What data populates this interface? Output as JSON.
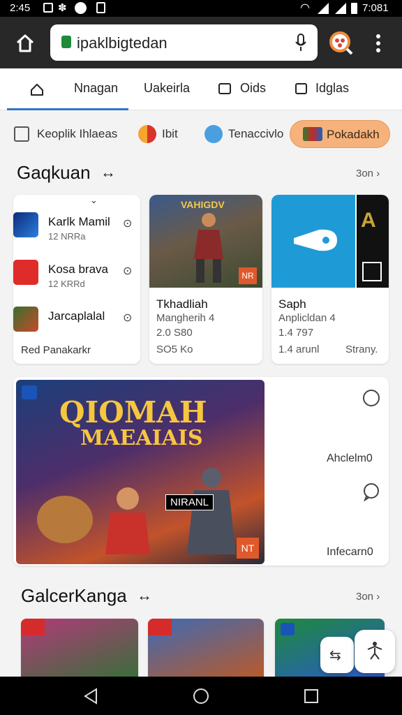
{
  "status": {
    "time_left": "2:45",
    "time_right": "7:081"
  },
  "toolbar": {
    "url": "ipaklbigtedan"
  },
  "tabs": [
    {
      "label": "Nnagan"
    },
    {
      "label": "Uakeirla"
    },
    {
      "label": "Oids"
    },
    {
      "label": "Idglas"
    }
  ],
  "chips": [
    {
      "label": "Keoplik Ihlaeas"
    },
    {
      "label": "Ibit"
    },
    {
      "label": "Tenaccivlo"
    },
    {
      "label": "Pokadakh"
    }
  ],
  "section1": {
    "title": "Gaqkuan",
    "see_all": "3on"
  },
  "list": [
    {
      "name": "Karlk Mamil",
      "sub": "12 NRRa"
    },
    {
      "name": "Kosa brava",
      "sub": "12 KRRd"
    },
    {
      "name": "Jarcaplalal",
      "sub": ""
    }
  ],
  "list_footer": "Red Panakarkr",
  "cards": [
    {
      "banner": "VAHIGDV",
      "title": "Tkhadliah",
      "sub1": "Mangherih 4",
      "sub2": "2.0 S80",
      "sub3": "SO5 Ko",
      "badge": "NR"
    },
    {
      "title": "Saph",
      "sub1": "Anplicldan 4",
      "sub2": "1.4 797",
      "sub3": "1.4 arunl",
      "sub4": "Strany."
    }
  ],
  "feature": {
    "title_line1": "QIOMAH",
    "title_line2": "MAEAIAIS",
    "label_mid": "NIRANL",
    "side1": "Ahclelm0",
    "side2": "Infecarn0",
    "badge": "NT"
  },
  "section2": {
    "title": "GalcerKanga",
    "see_all": "3on"
  },
  "colors": {
    "accent": "#2f74c8",
    "chip_active": "#f6b27a",
    "toolbar": "#282828"
  }
}
